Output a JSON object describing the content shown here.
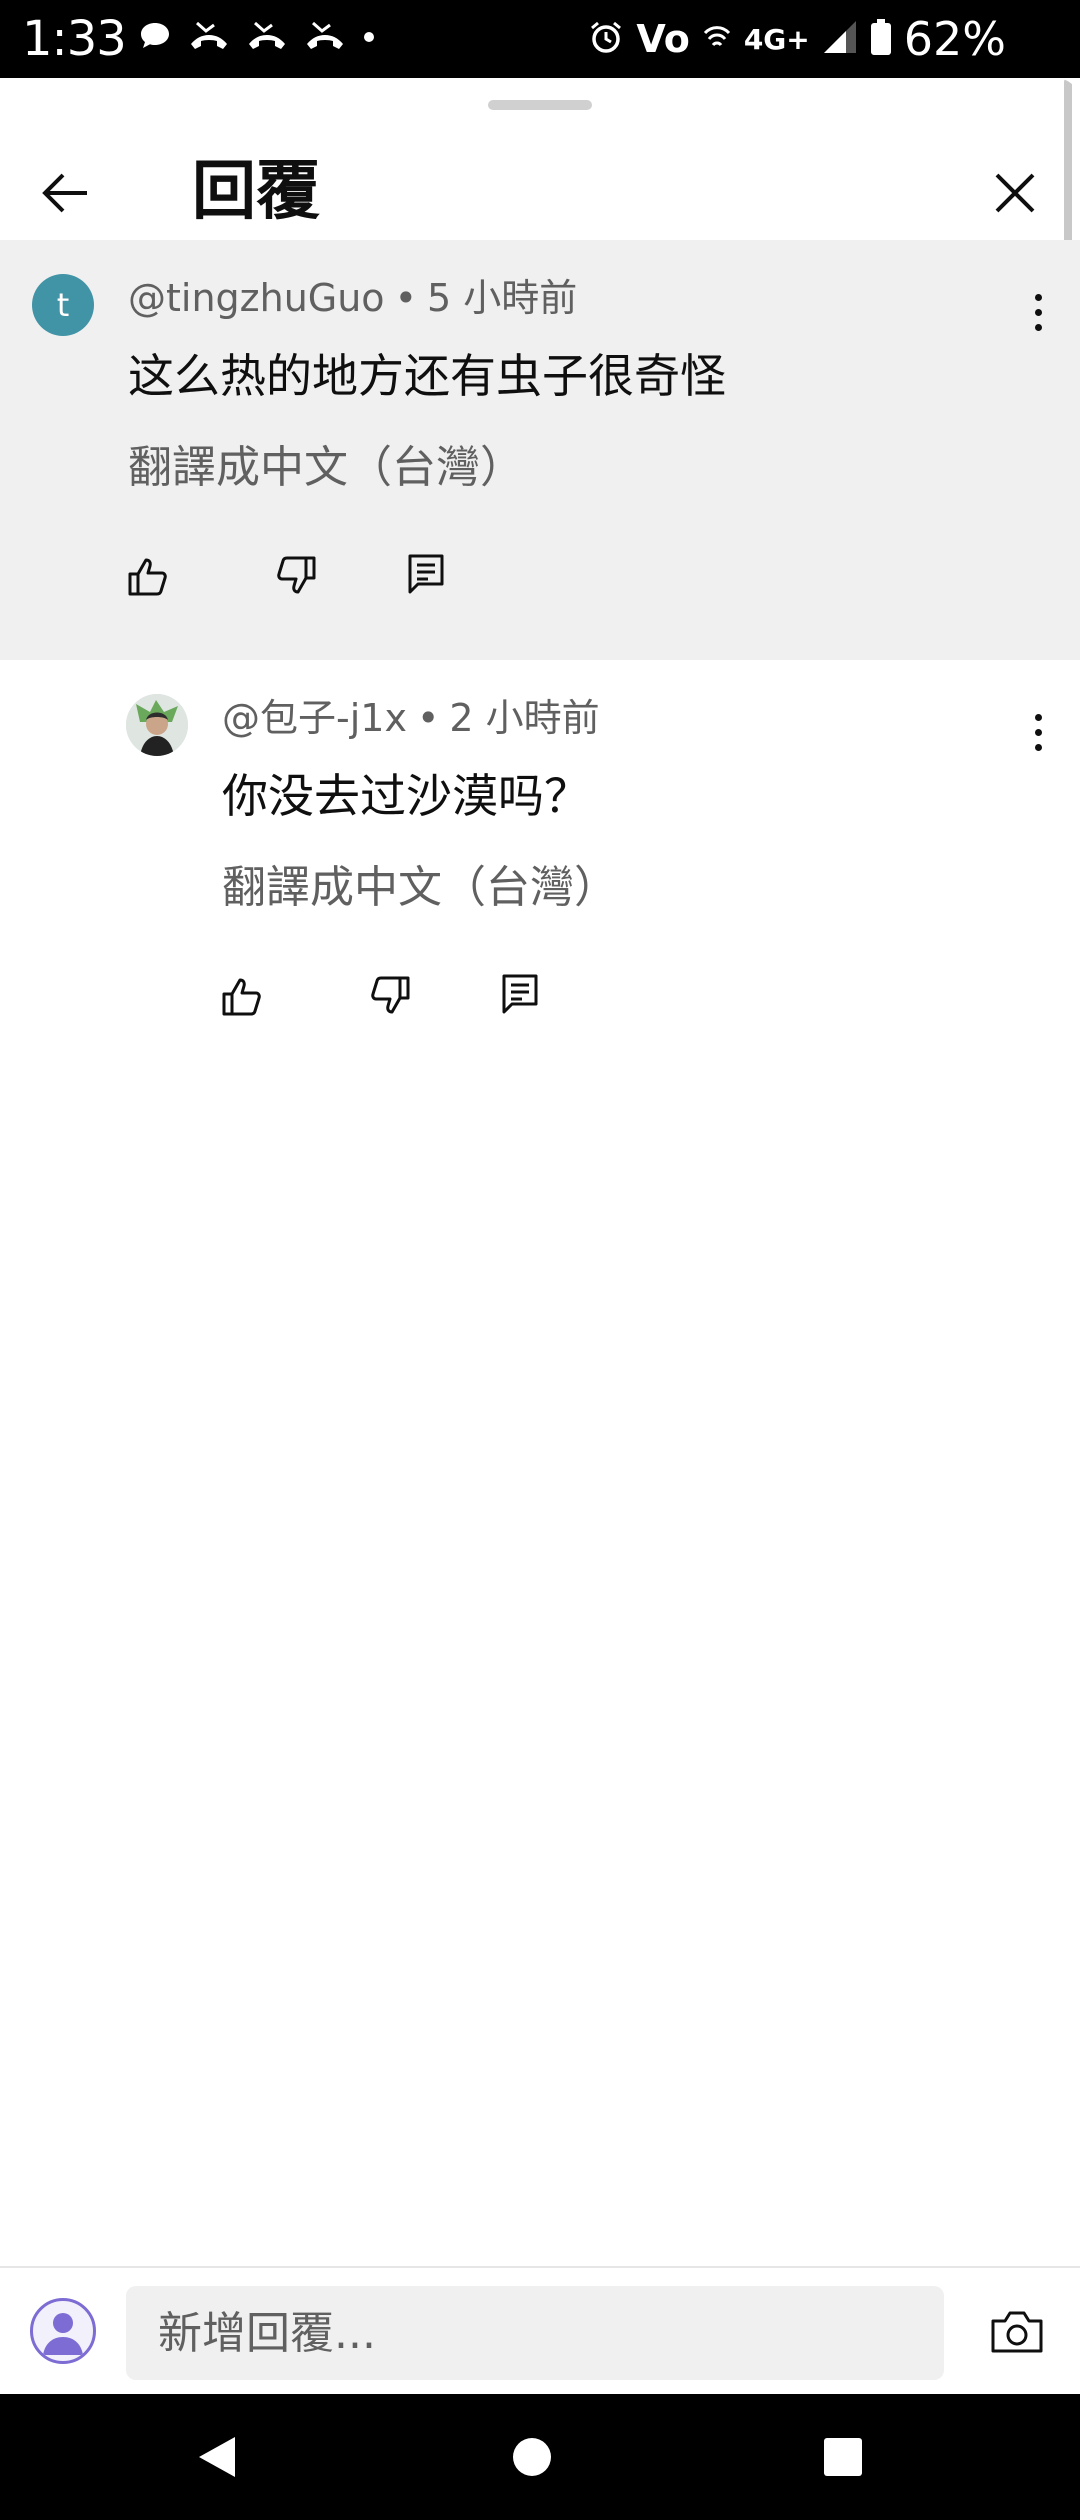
{
  "status_bar": {
    "time": "1:33",
    "network": "4G+",
    "volte": "Vo",
    "battery": "62%",
    "icons": [
      "chat-bubble-icon",
      "missed-call-icon",
      "missed-call-icon",
      "missed-call-icon",
      "dot-icon",
      "alarm-icon",
      "wifi-calling-icon",
      "signal-icon",
      "battery-icon"
    ]
  },
  "header": {
    "title": "回覆",
    "back_icon": "arrow-left-icon",
    "close_icon": "close-icon"
  },
  "comments": [
    {
      "avatar_letter": "t",
      "avatar_color": "#4193a6",
      "author": "@tingzhuGuo",
      "separator": "•",
      "time": "5 小時前",
      "text": "这么热的地方还有虫子很奇怪",
      "translate": "翻譯成中文（台灣）",
      "highlighted": true
    },
    {
      "author": "@包子-j1x",
      "separator": "•",
      "time": "2 小時前",
      "text": "你没去过沙漠吗？",
      "translate": "翻譯成中文（台灣）",
      "highlighted": false
    }
  ],
  "composer": {
    "placeholder": "新增回覆...",
    "camera_icon": "camera-icon"
  },
  "colors": {
    "highlight_bg": "#f0f0f0",
    "secondary_text": "#606060",
    "primary_text": "#0f0f0f",
    "avatar_t": "#4193a6"
  }
}
